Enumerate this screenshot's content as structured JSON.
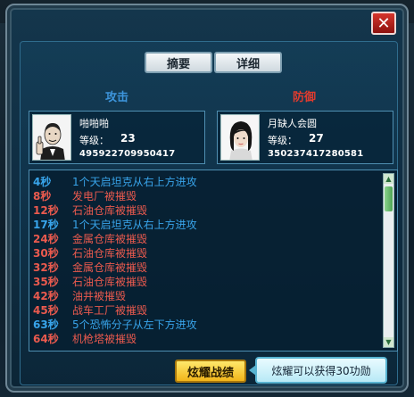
{
  "dialog": {
    "close_symbol": "✕",
    "tabs": {
      "summary": "摘要",
      "detail": "详细"
    },
    "sides": {
      "attack": "攻击",
      "defend": "防御"
    },
    "share_button": "炫耀战绩",
    "tip": "炫耀可以获得30功勋",
    "colors": {
      "attack": "#3d95dc",
      "defend": "#e03b2e",
      "share": "#f2b51a"
    }
  },
  "attacker": {
    "name": "啪啪啪",
    "level_label": "等级：",
    "level": "23",
    "id": "495922709950417",
    "avatar_icon": "man-portrait-icon"
  },
  "defender": {
    "name": "月缺人会圆",
    "level_label": "等级：",
    "level": "27",
    "id": "350237417280581",
    "avatar_icon": "woman-portrait-icon"
  },
  "battle_log": [
    {
      "time": "4秒",
      "text": "1个天启坦克从右上方进攻",
      "side": "blue"
    },
    {
      "time": "8秒",
      "text": "发电厂被摧毁",
      "side": "red"
    },
    {
      "time": "12秒",
      "text": "石油仓库被摧毁",
      "side": "red"
    },
    {
      "time": "17秒",
      "text": "1个天启坦克从右上方进攻",
      "side": "blue"
    },
    {
      "time": "24秒",
      "text": "金属仓库被摧毁",
      "side": "red"
    },
    {
      "time": "30秒",
      "text": "石油仓库被摧毁",
      "side": "red"
    },
    {
      "time": "32秒",
      "text": "金属仓库被摧毁",
      "side": "red"
    },
    {
      "time": "35秒",
      "text": "石油仓库被摧毁",
      "side": "red"
    },
    {
      "time": "42秒",
      "text": "油井被摧毁",
      "side": "red"
    },
    {
      "time": "45秒",
      "text": "战车工厂被摧毁",
      "side": "red"
    },
    {
      "time": "63秒",
      "text": "5个恐怖分子从左下方进攻",
      "side": "blue"
    },
    {
      "time": "64秒",
      "text": "机枪塔被摧毁",
      "side": "red"
    }
  ]
}
